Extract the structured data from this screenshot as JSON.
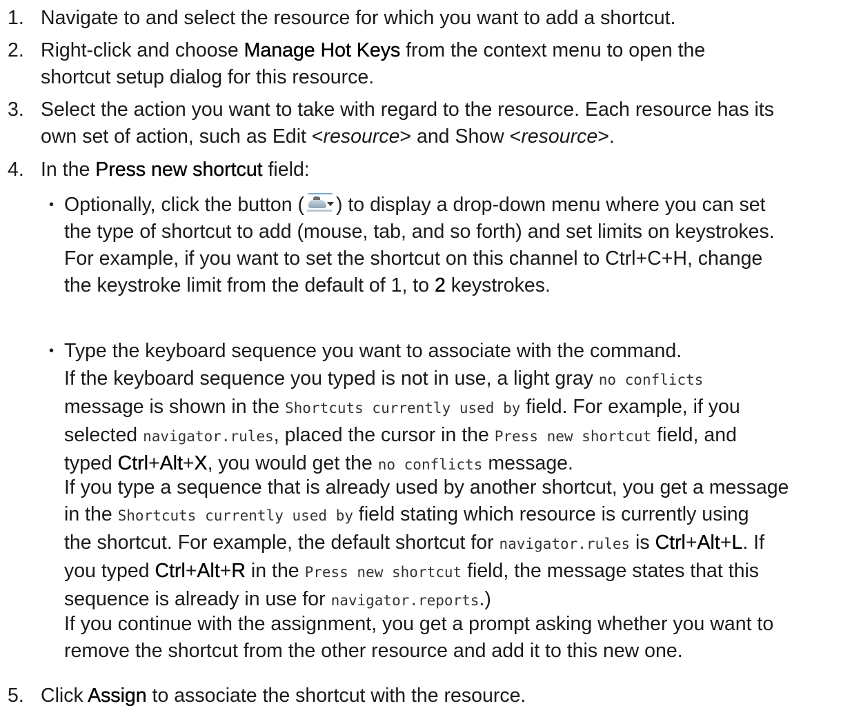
{
  "steps": [
    {
      "n": "1.",
      "text": "Navigate to and select the resource for which you want to add a shortcut."
    },
    {
      "n": "2.",
      "a": "Right-click and choose ",
      "b": "Manage Hot Keys",
      "c": " from the context menu to open the",
      "d": "shortcut setup dialog for this resource."
    },
    {
      "n": "3.",
      "a": "Select the action you want to take with regard to the resource. Each resource has its",
      "b": "own set of action, such as Edit <",
      "c": "resource",
      "d": "> and Show <",
      "e": "resource",
      "f": ">."
    },
    {
      "n": "4.",
      "a": "In the ",
      "b": "Press new shortcut",
      "c": " field:"
    },
    {
      "n": "5.",
      "a": "Click ",
      "b": "Assign",
      "c": " to associate the shortcut with the resource."
    }
  ],
  "bullet1": {
    "a": "Optionally, click the button (",
    "icon": "dropdown-button-icon",
    "b": ") to display a drop-down menu where you can set",
    "c": "the type of shortcut to add (mouse, tab, and so forth) and set limits on keystrokes.",
    "d": "For example, if you want to set the shortcut on this channel to Ctrl+C+H, change",
    "e": "the keystroke limit from the default of 1, to ",
    "f": "2",
    "g": " keystrokes."
  },
  "bullet2": {
    "text": "Type the keyboard sequence you want to associate with the command."
  },
  "para1": {
    "a": "If the keyboard sequence you typed is not in use, a light gray ",
    "code1": "no conflicts",
    "b": "message is shown in the ",
    "code2": "Shortcuts currently used by",
    "c": " field. For example, if you",
    "d": "selected ",
    "code3": "navigator.rules",
    "e": ", placed the cursor in the ",
    "code4": "Press new shortcut",
    "f": " field, and",
    "g": "typed ",
    "k1": "Ctrl",
    "h": "+",
    "k2": "Alt",
    "i": "+",
    "k3": "X",
    "j": ", you would get the ",
    "code5": "no conflicts",
    "k": " message."
  },
  "para2": {
    "a": "If you type a sequence that is already used by another shortcut, you get a message",
    "b": "in the ",
    "code1": "Shortcuts currently used by",
    "c": " field stating which resource is currently using",
    "d": "the shortcut. For example, the default shortcut for ",
    "code2": "navigator.rules",
    "e": " is ",
    "k1": "Ctrl",
    "f": "+",
    "k2": "Alt",
    "g": "+",
    "k3": "L",
    "h": ". If",
    "i": "you typed ",
    "k4": "Ctrl",
    "j": "+",
    "k5": "Alt",
    "k": "+",
    "k6": "R",
    "l": " in the ",
    "code3": "Press new shortcut",
    "m": " field, the message states that this",
    "n": "sequence is already in use for ",
    "code4": "navigator.reports",
    "o": ".)"
  },
  "para3": {
    "a": "If you continue with the assignment, you get a prompt asking whether you want to",
    "b": "remove the shortcut from the other resource and add it to this new one."
  }
}
